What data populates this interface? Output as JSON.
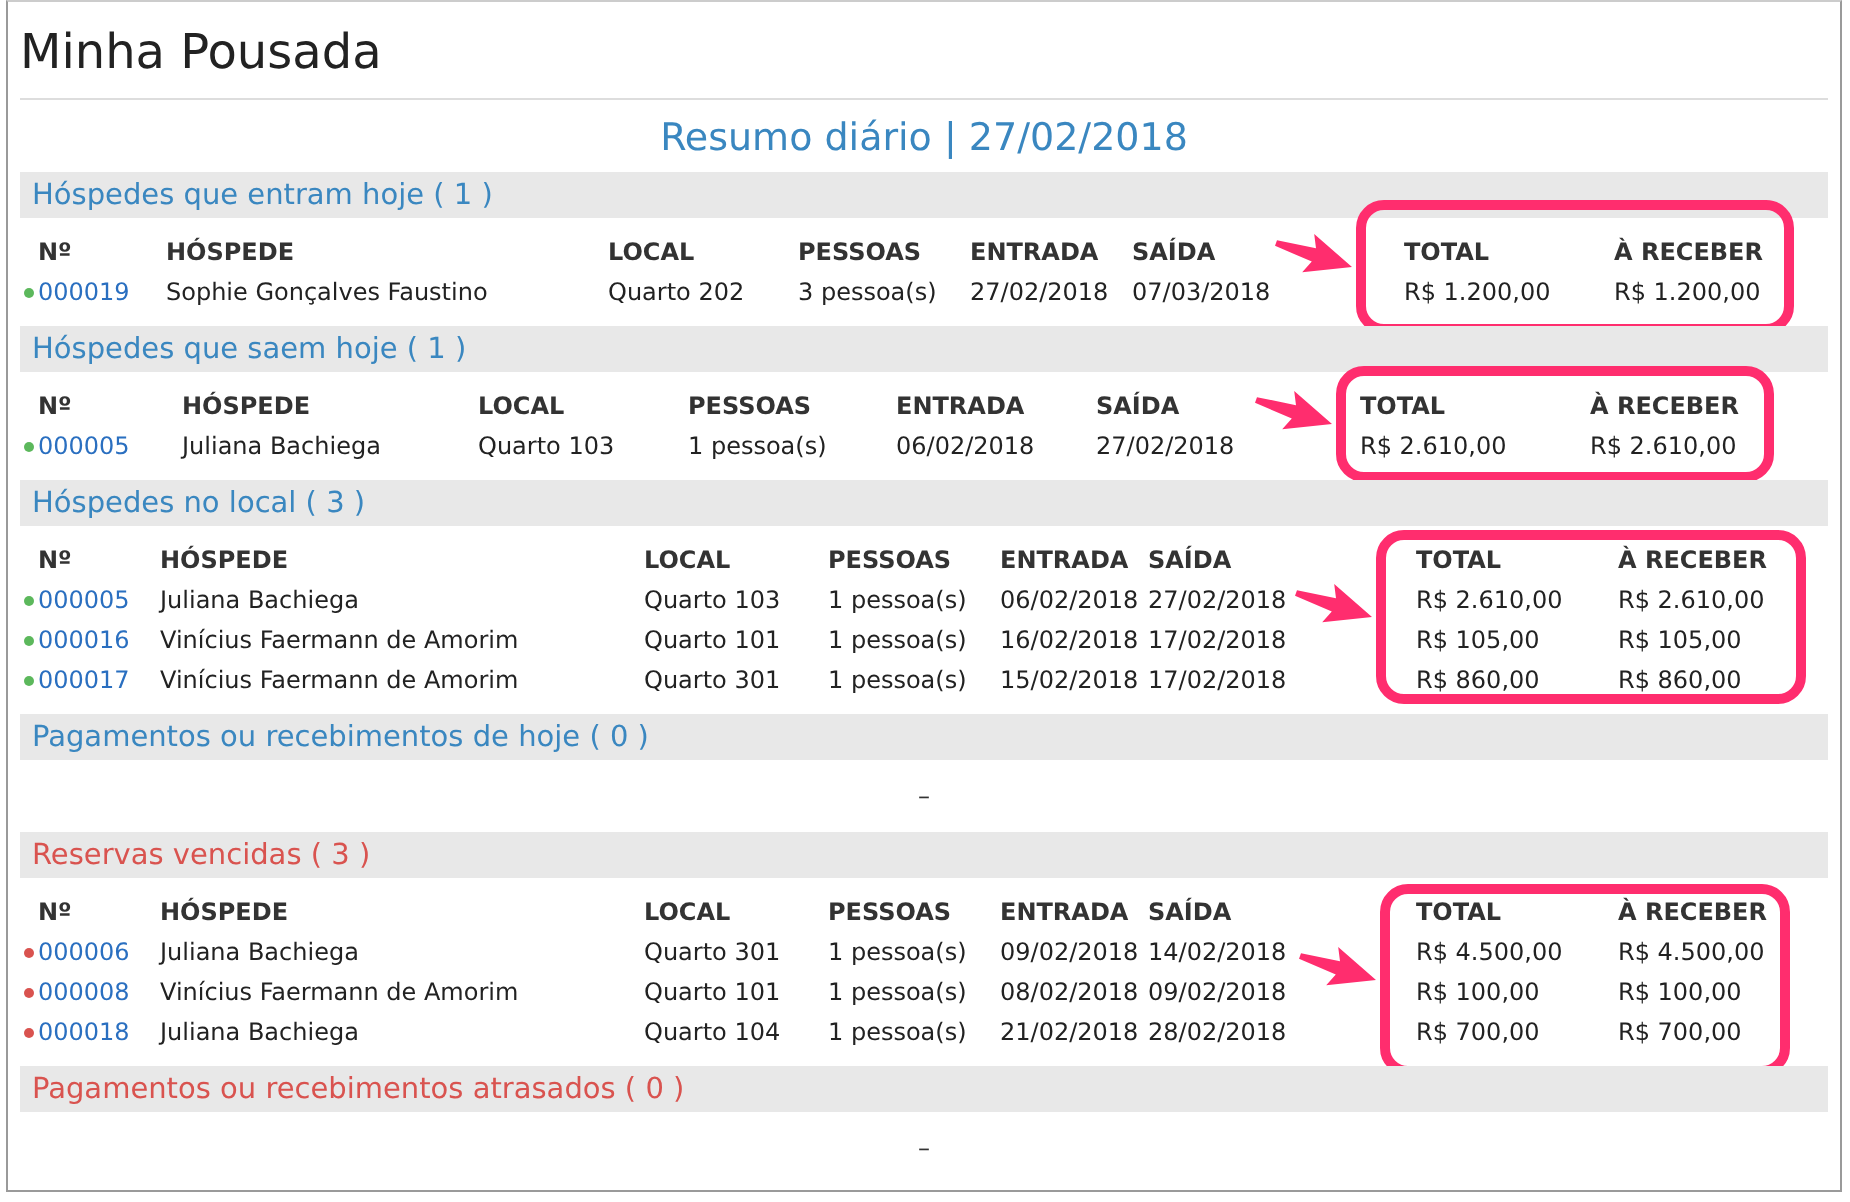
{
  "title": "Minha Pousada",
  "subtitle": "Resumo diário | 27/02/2018",
  "sections": [
    {
      "title": "Hóspedes que entram hoje ( 1 )",
      "color": "#3a87c0",
      "columns": [
        "Nº",
        "HÓSPEDE",
        "LOCAL",
        "PESSOAS",
        "ENTRADA",
        "SAÍDA",
        "TOTAL",
        "À RECEBER"
      ],
      "rows": [
        {
          "color": "#5cb85c",
          "cells": [
            "000019",
            "Sophie Gonçalves Faustino",
            "Quarto 202",
            "3 pessoa(s)",
            "27/02/2018",
            "07/03/2018",
            "R$ 1.200,00",
            "R$ 1.200,00"
          ]
        }
      ]
    },
    {
      "title": "Hóspedes que saem hoje ( 1 )",
      "color": "#3a87c0",
      "columns": [
        "Nº",
        "HÓSPEDE",
        "LOCAL",
        "PESSOAS",
        "ENTRADA",
        "SAÍDA",
        "TOTAL",
        "À RECEBER"
      ],
      "rows": [
        {
          "color": "#5cb85c",
          "cells": [
            "000005",
            "Juliana Bachiega",
            "Quarto 103",
            "1 pessoa(s)",
            "06/02/2018",
            "27/02/2018",
            "R$ 2.610,00",
            "R$ 2.610,00"
          ]
        }
      ]
    },
    {
      "title": "Hóspedes no local ( 3 )",
      "color": "#3a87c0",
      "columns": [
        "Nº",
        "HÓSPEDE",
        "LOCAL",
        "PESSOAS",
        "ENTRADA",
        "SAÍDA",
        "TOTAL",
        "À RECEBER"
      ],
      "rows": [
        {
          "color": "#5cb85c",
          "cells": [
            "000005",
            "Juliana Bachiega",
            "Quarto 103",
            "1 pessoa(s)",
            "06/02/2018",
            "27/02/2018",
            "R$ 2.610,00",
            "R$ 2.610,00"
          ]
        },
        {
          "color": "#5cb85c",
          "cells": [
            "000016",
            "Vinícius Faermann de Amorim",
            "Quarto 101",
            "1 pessoa(s)",
            "16/02/2018",
            "17/02/2018",
            "R$ 105,00",
            "R$ 105,00"
          ]
        },
        {
          "color": "#5cb85c",
          "cells": [
            "000017",
            "Vinícius Faermann de Amorim",
            "Quarto 301",
            "1 pessoa(s)",
            "15/02/2018",
            "17/02/2018",
            "R$ 860,00",
            "R$ 860,00"
          ]
        }
      ]
    },
    {
      "title": "Pagamentos ou recebimentos de hoje ( 0 )",
      "color": "#3a87c0",
      "empty_text": "–"
    },
    {
      "title": "Reservas vencidas ( 3 )",
      "color": "#d9534f",
      "columns": [
        "Nº",
        "HÓSPEDE",
        "LOCAL",
        "PESSOAS",
        "ENTRADA",
        "SAÍDA",
        "TOTAL",
        "À RECEBER"
      ],
      "rows": [
        {
          "color": "#d9534f",
          "cells": [
            "000006",
            "Juliana Bachiega",
            "Quarto 301",
            "1 pessoa(s)",
            "09/02/2018",
            "14/02/2018",
            "R$ 4.500,00",
            "R$ 4.500,00"
          ]
        },
        {
          "color": "#d9534f",
          "cells": [
            "000008",
            "Vinícius Faermann de Amorim",
            "Quarto 101",
            "1 pessoa(s)",
            "08/02/2018",
            "09/02/2018",
            "R$ 100,00",
            "R$ 100,00"
          ]
        },
        {
          "color": "#d9534f",
          "cells": [
            "000018",
            "Juliana Bachiega",
            "Quarto 104",
            "1 pessoa(s)",
            "21/02/2018",
            "28/02/2018",
            "R$ 700,00",
            "R$ 700,00"
          ]
        }
      ]
    },
    {
      "title": "Pagamentos ou recebimentos atrasados ( 0 )",
      "color": "#d9534f",
      "empty_text": "–"
    }
  ]
}
